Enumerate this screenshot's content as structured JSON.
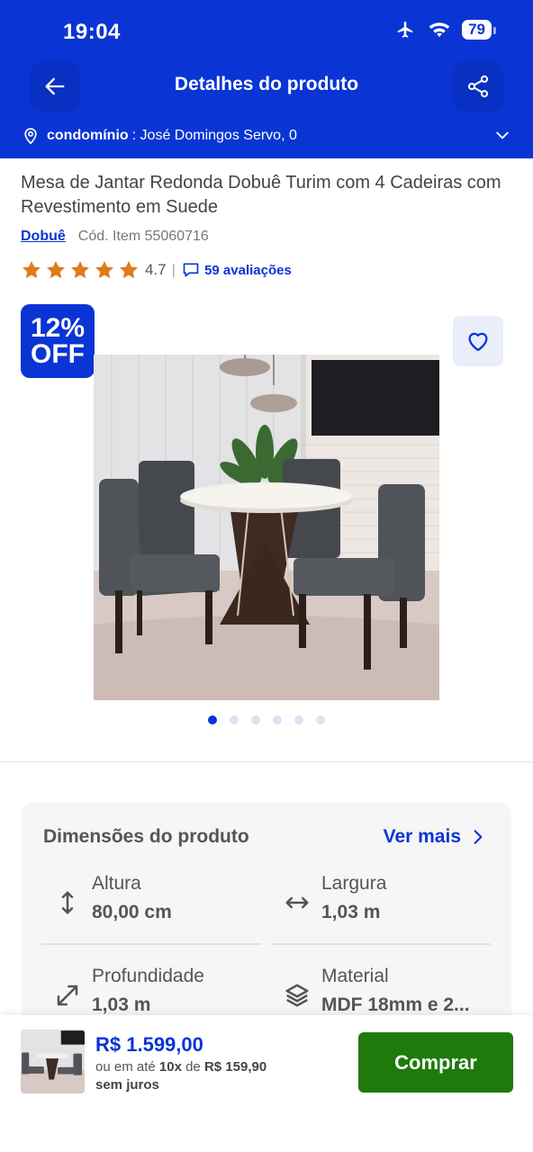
{
  "status_bar": {
    "time": "19:04",
    "battery": "79"
  },
  "header": {
    "title": "Detalhes do produto",
    "address_label": "condomínio",
    "address_value": ": José Domingos Servo, 0"
  },
  "product": {
    "title": "Mesa de Jantar Redonda Dobuê Turim com 4 Cadeiras com Revestimento em Suede",
    "brand": "Dobuê",
    "code": "Cód. Item 55060716",
    "rating": "4.7",
    "rating_value": 4.7,
    "rating_max": 5,
    "reviews": "59 avaliações",
    "discount_pct": "12%",
    "discount_off": "OFF",
    "image_count": 6,
    "active_image": 1
  },
  "dimensions": {
    "title": "Dimensões do produto",
    "see_more": "Ver mais",
    "items": [
      {
        "label": "Altura",
        "value": "80,00 cm",
        "icon": "vertical-arrows-icon"
      },
      {
        "label": "Largura",
        "value": "1,03 m",
        "icon": "horizontal-arrows-icon"
      },
      {
        "label": "Profundidade",
        "value": "1,03 m",
        "icon": "diagonal-arrows-icon"
      },
      {
        "label": "Material",
        "value": "MDF 18mm e 2...",
        "icon": "layers-icon"
      }
    ]
  },
  "purchase": {
    "price": "R$ 1.599,00",
    "installment_prefix": "ou em até",
    "installment_count": "10x",
    "installment_mid": "de",
    "installment_value": "R$ 159,90",
    "installment_suffix": "sem juros",
    "buy_label": "Comprar"
  },
  "colors": {
    "primary": "#0a35d4",
    "buy": "#1f7a0b",
    "star": "#e07b1a"
  }
}
